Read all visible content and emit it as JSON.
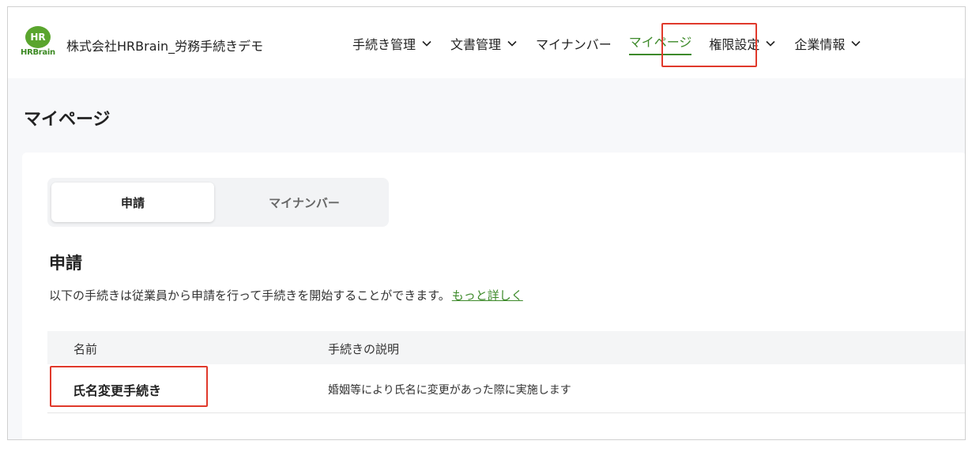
{
  "header": {
    "logo_text": "HR",
    "logo_subtext": "HRBrain",
    "company": "株式会社HRBrain_労務手続きデモ",
    "nav": [
      {
        "label": "手続き管理",
        "has_dropdown": true
      },
      {
        "label": "文書管理",
        "has_dropdown": true
      },
      {
        "label": "マイナンバー",
        "has_dropdown": false
      },
      {
        "label": "マイページ",
        "has_dropdown": false,
        "active": true
      },
      {
        "label": "権限設定",
        "has_dropdown": true
      },
      {
        "label": "企業情報",
        "has_dropdown": true
      }
    ]
  },
  "page": {
    "title": "マイページ",
    "tabs": [
      {
        "label": "申請",
        "selected": true
      },
      {
        "label": "マイナンバー",
        "selected": false
      }
    ],
    "section_title": "申請",
    "description": "以下の手続きは従業員から申請を行って手続きを開始することができます。",
    "more_link": "もっと詳しく",
    "table": {
      "headers": {
        "name": "名前",
        "description": "手続きの説明"
      },
      "rows": [
        {
          "name": "氏名変更手続き",
          "description": "婚姻等により氏名に変更があった際に実施します"
        }
      ]
    }
  },
  "colors": {
    "accent": "#3d8a2a",
    "highlight": "#e0392b"
  }
}
